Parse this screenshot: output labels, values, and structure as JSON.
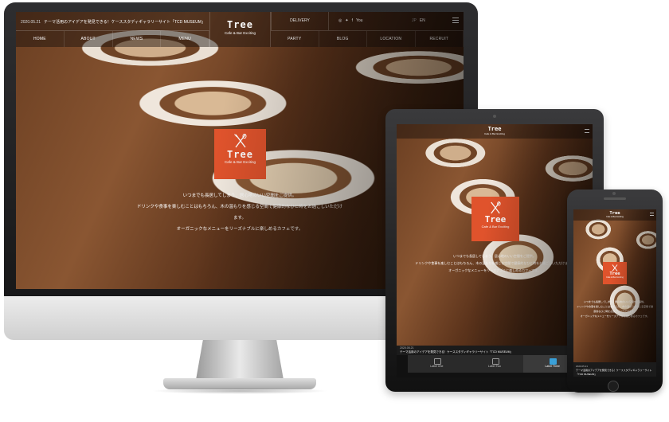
{
  "brand": {
    "name": "Tree",
    "tagline": "Cafe & Bar Exciting",
    "accent_color": "#e0532c"
  },
  "desktop": {
    "news": {
      "date": "2020.05.21",
      "text": "テーマ活用のアイデアを発見できる！ケーススタディギャラリーサイト「TCD MUSEUM」"
    },
    "nav_left": [
      "HOME",
      "ABOUT",
      "NEWS",
      "MENU"
    ],
    "nav_right": [
      "PARTY",
      "BLOG",
      "LOCATION",
      "RECRUIT"
    ],
    "delivery": "DELIVERY",
    "social_icons": [
      "instagram-icon",
      "twitter-icon",
      "facebook-icon",
      "youtube-icon"
    ],
    "social_glyphs": [
      "◎",
      "✦",
      "f",
      "You"
    ],
    "lang": {
      "jp": "JP",
      "en": "EN"
    },
    "copy": [
      "いつまでも長居してしまう、居心地のいい空間をご提供。",
      "ドリンクや食事を楽しむことはもちろん、木の温もりを感じる空間で健康的なひと時をお過ごしいただけます。",
      "オーガニックなメニューをリーズナブルに楽しめるカフェです。"
    ]
  },
  "tablet": {
    "copy": [
      "いつまでも長居してしまう、居心地のいい空間をご提供。",
      "ドリンクや食事を楽しむことはもちろん、木の温もりを感じる空間で健康的なひと時をお過ごしいただけます。",
      "オーガニックなメニューをリーズナブルに楽しめるカフェです。"
    ],
    "news": {
      "date": "2020.05.21",
      "text": "テーマ活用のアイデアを発見できる！ケーススタディギャラリーサイト「TCD MUSEUM」"
    },
    "tabs": [
      "Label One",
      "Label Two",
      "Label Three"
    ]
  },
  "phone": {
    "copy": [
      "いつまでも長居してしまう、居心地のいい空間をご提供。",
      "ドリンクや食事を楽しむことはもちろん、木の温もりを感じる空間で健康的なひと時をお過ごしいただけます。",
      "オーガニックなメニューをリーズナブルに楽しめるカフェです。"
    ],
    "news": {
      "date": "2020.05.21",
      "text": "テーマ活用のアイデアを発見できる！ケーススタディギャラリーサイト「TCD MUSEUM」"
    }
  }
}
